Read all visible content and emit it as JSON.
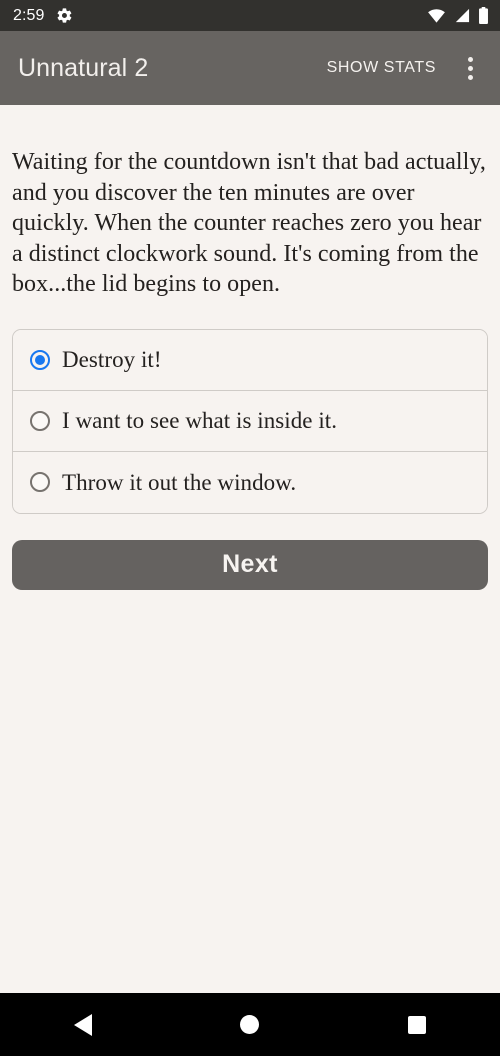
{
  "status_bar": {
    "time": "2:59",
    "icons": [
      "gear-icon",
      "wifi-icon",
      "cellular-signal-icon",
      "battery-icon"
    ]
  },
  "app_bar": {
    "title": "Unnatural 2",
    "show_stats_label": "SHOW STATS",
    "overflow_label": "More options"
  },
  "story": {
    "text": "Waiting for the countdown isn't that bad actually, and you discover the ten minutes are over quickly. When the counter reaches zero you hear a distinct clockwork sound. It's coming from the box...the lid begins to open."
  },
  "options": [
    {
      "label": "Destroy it!",
      "selected": true
    },
    {
      "label": "I want to see what is inside it.",
      "selected": false
    },
    {
      "label": "Throw it out the window.",
      "selected": false
    }
  ],
  "next_button": {
    "label": "Next"
  },
  "nav_bar": {
    "back_label": "Back",
    "home_label": "Home",
    "recents_label": "Recents"
  },
  "colors": {
    "status_bar_bg": "#32312e",
    "app_bar_bg": "#676461",
    "content_bg": "#f7f3f0",
    "accent_selected": "#1878f0",
    "button_bg": "#656260",
    "nav_bar_bg": "#000000",
    "text_primary": "#24211f",
    "border": "#cfcbc7"
  }
}
